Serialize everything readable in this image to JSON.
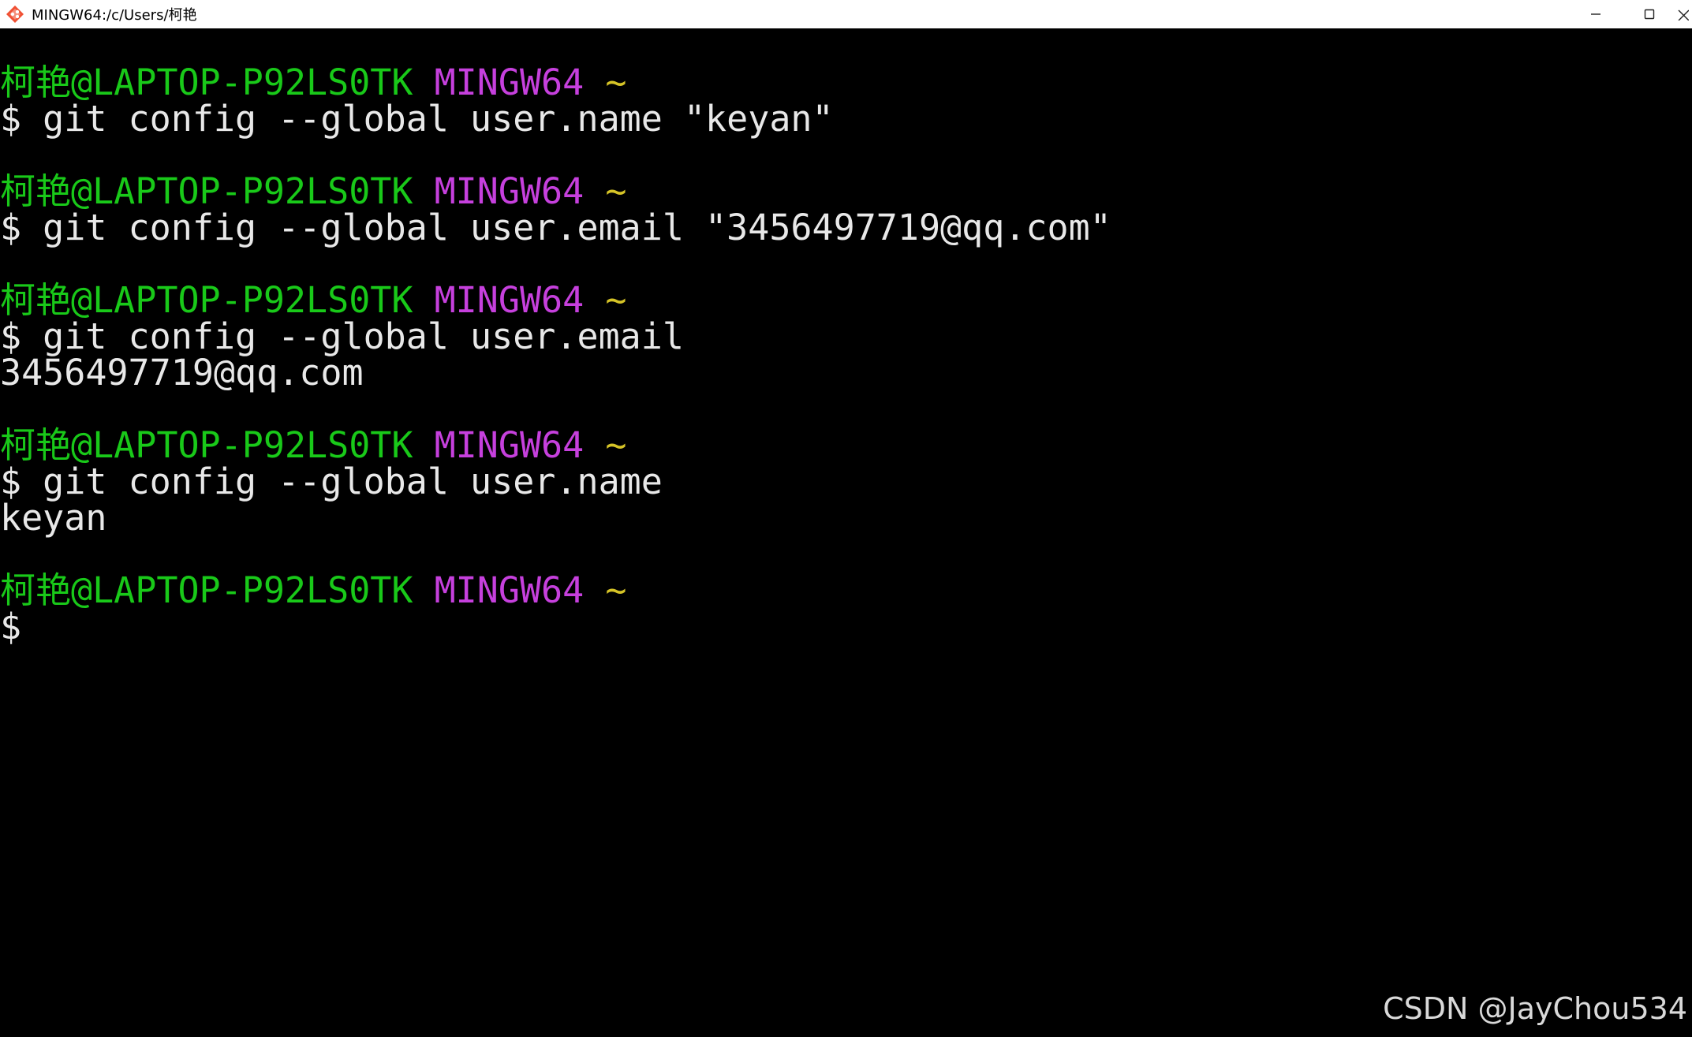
{
  "window": {
    "title": "MINGW64:/c/Users/柯艳",
    "controls": {
      "minimize": "—",
      "maximize": "☐",
      "close": "×"
    }
  },
  "terminal": {
    "blocks": [
      {
        "prompt": {
          "user_host": "柯艳@LAPTOP-P92LS0TK",
          "system": "MINGW64",
          "path": "~"
        },
        "command": "$ git config --global user.name \"keyan\"",
        "output": []
      },
      {
        "prompt": {
          "user_host": "柯艳@LAPTOP-P92LS0TK",
          "system": "MINGW64",
          "path": "~"
        },
        "command": "$ git config --global user.email \"3456497719@qq.com\"",
        "output": []
      },
      {
        "prompt": {
          "user_host": "柯艳@LAPTOP-P92LS0TK",
          "system": "MINGW64",
          "path": "~"
        },
        "command": "$ git config --global user.email",
        "output": [
          "3456497719@qq.com"
        ]
      },
      {
        "prompt": {
          "user_host": "柯艳@LAPTOP-P92LS0TK",
          "system": "MINGW64",
          "path": "~"
        },
        "command": "$ git config --global user.name",
        "output": [
          "keyan"
        ]
      },
      {
        "prompt": {
          "user_host": "柯艳@LAPTOP-P92LS0TK",
          "system": "MINGW64",
          "path": "~"
        },
        "command": "$",
        "output": []
      }
    ],
    "colors": {
      "background": "#000000",
      "user_host": "#19c919",
      "system": "#c640dd",
      "path": "#d6c427",
      "text": "#e8e8e8"
    }
  },
  "watermark": "CSDN @JayChou534"
}
